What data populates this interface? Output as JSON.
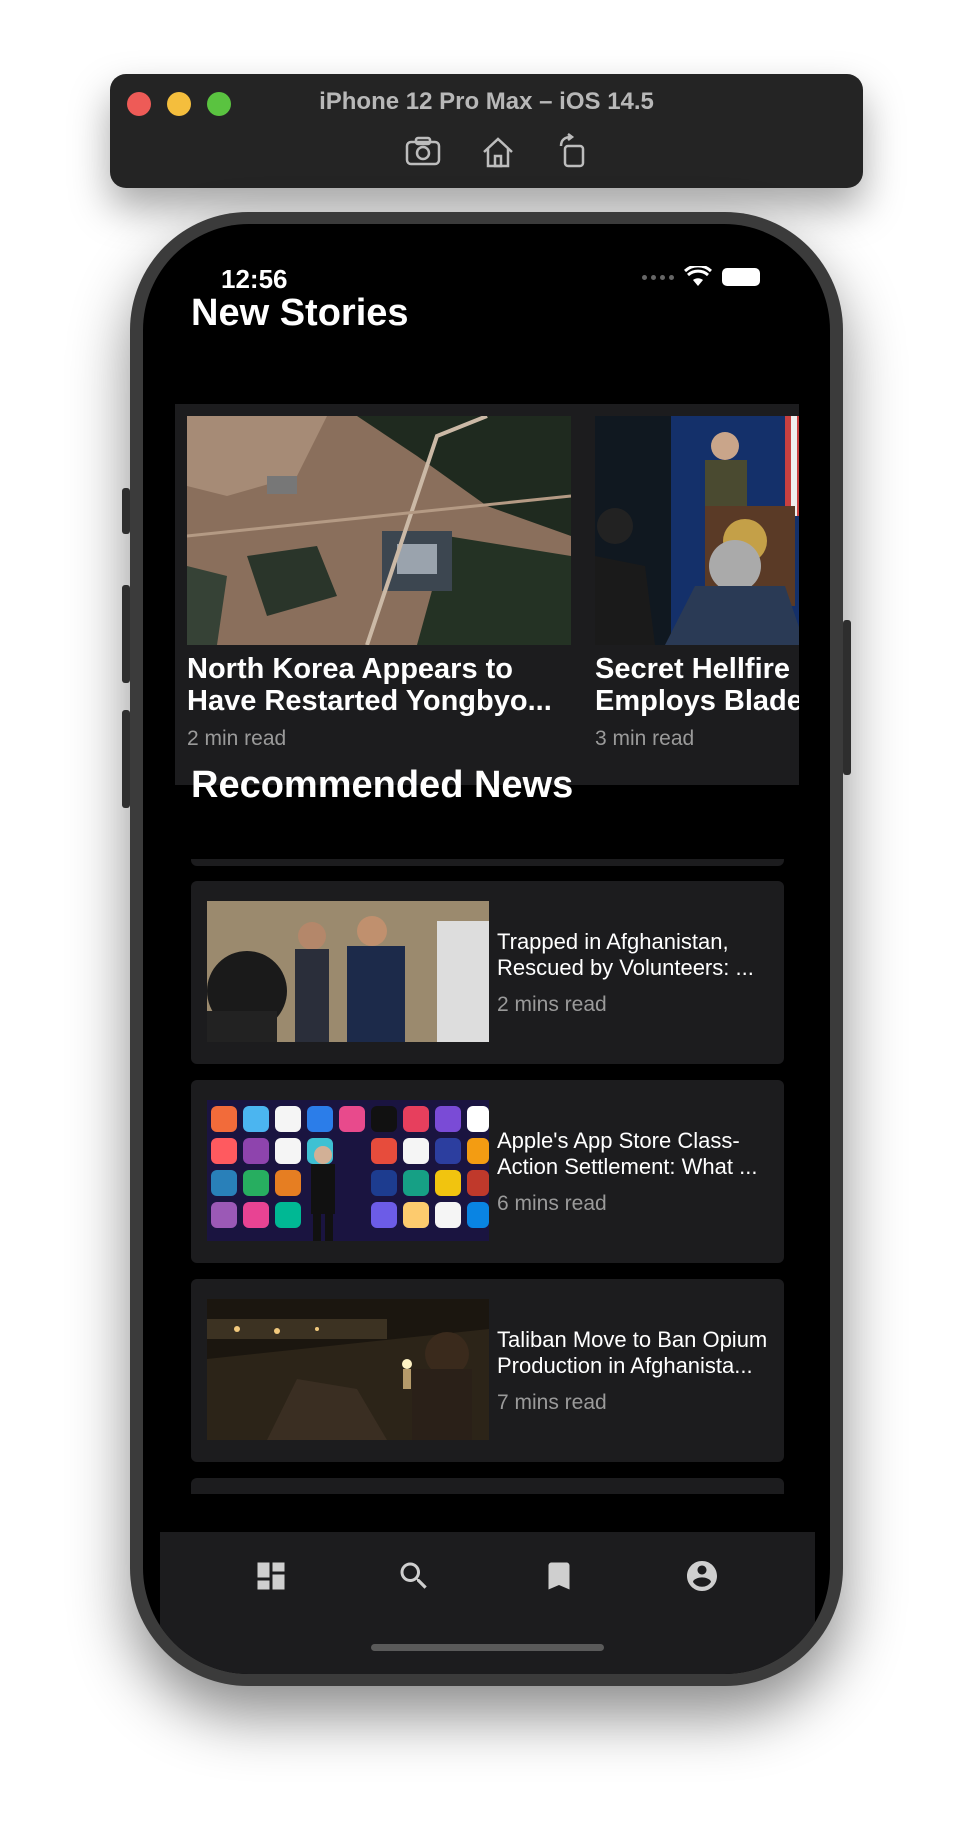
{
  "simulator": {
    "title": "iPhone 12 Pro Max – iOS 14.5",
    "tools": [
      "screenshot-icon",
      "home-icon",
      "rotate-icon"
    ]
  },
  "status_bar": {
    "time": "12:56"
  },
  "new_stories": {
    "title": "New Stories",
    "items": [
      {
        "title": "North Korea Appears to\nHave Restarted Yongbyo...",
        "meta": "2 min read",
        "image": "satellite-image"
      },
      {
        "title": "Secret Hellfire\nEmploys Blades",
        "meta": "3 min read",
        "image": "press-briefing-image"
      }
    ]
  },
  "recommended": {
    "title": "Recommended News",
    "items": [
      {
        "title": "Trapped in Afghanistan,\nRescued by Volunteers: ...",
        "meta": "2 mins read",
        "image": "two-men-photo"
      },
      {
        "title": "Apple's App Store Class-\nAction Settlement: What ...",
        "meta": "6 mins read",
        "image": "app-icons-stage-photo"
      },
      {
        "title": "Taliban Move to Ban Opium\nProduction in Afghanista...",
        "meta": "7 mins read",
        "image": "night-camp-photo"
      }
    ]
  },
  "tab_bar": {
    "tabs": [
      "dashboard-icon",
      "search-icon",
      "bookmark-icon",
      "account-icon"
    ]
  },
  "colors": {
    "background": "#000000",
    "card": "#1c1c1e",
    "text": "#ffffff",
    "secondary_text": "#9a9a9a"
  }
}
